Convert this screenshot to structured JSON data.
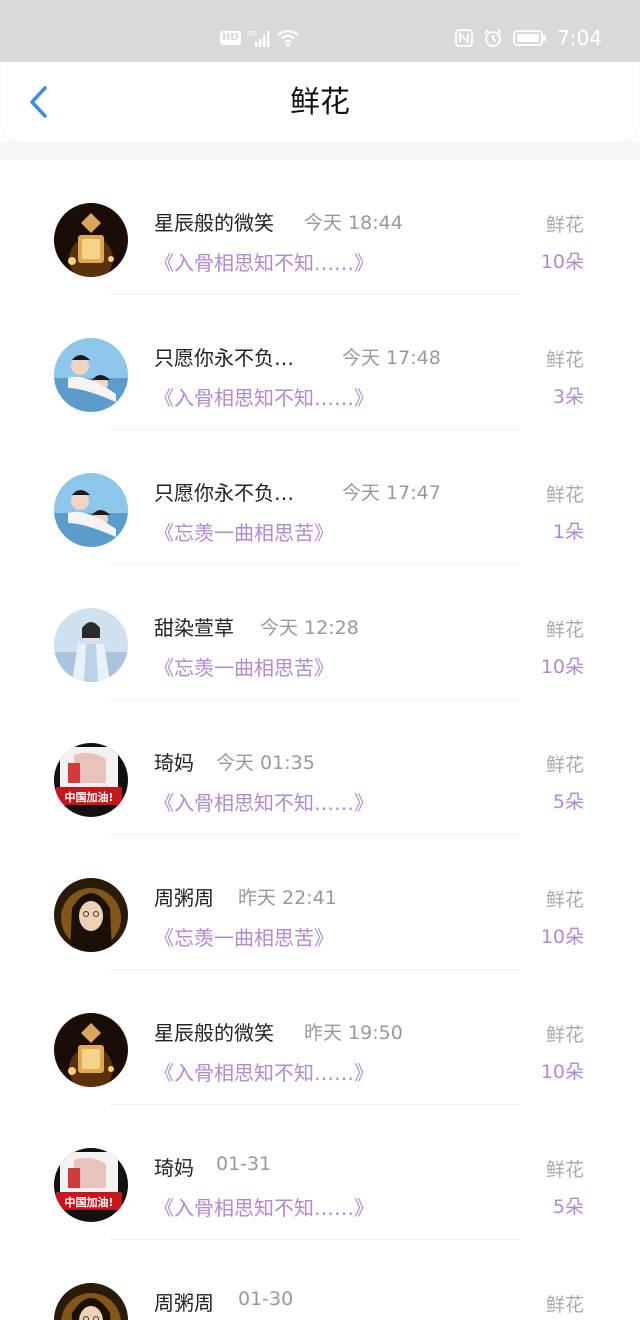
{
  "status_bar": {
    "hd": "HD",
    "network": "5G",
    "time": "7:04"
  },
  "header": {
    "title": "鲜花"
  },
  "items": [
    {
      "name": "星辰般的微笑",
      "time": "今天 18:44",
      "work": "《入骨相思知不知……》",
      "gift": "鲜花",
      "count": "10朵",
      "avatar": "perfume-bottle"
    },
    {
      "name": "只愿你永不负…",
      "time": "今天 17:48",
      "work": "《入骨相思知不知……》",
      "gift": "鲜花",
      "count": "3朵",
      "avatar": "couple-blue"
    },
    {
      "name": "只愿你永不负…",
      "time": "今天 17:47",
      "work": "《忘羡一曲相思苦》",
      "gift": "鲜花",
      "count": "1朵",
      "avatar": "couple-blue"
    },
    {
      "name": "甜染萱草",
      "time": "今天 12:28",
      "work": "《忘羡一曲相思苦》",
      "gift": "鲜花",
      "count": "10朵",
      "avatar": "costume-figure"
    },
    {
      "name": "琦妈",
      "time": "今天 01:35",
      "work": "《入骨相思知不知……》",
      "gift": "鲜花",
      "count": "5朵",
      "avatar": "china-banner",
      "avatar_text": "中国加油!"
    },
    {
      "name": "周粥周",
      "time": "昨天 22:41",
      "work": "《忘羡一曲相思苦》",
      "gift": "鲜花",
      "count": "10朵",
      "avatar": "woman-portrait"
    },
    {
      "name": "星辰般的微笑",
      "time": "昨天 19:50",
      "work": "《入骨相思知不知……》",
      "gift": "鲜花",
      "count": "10朵",
      "avatar": "perfume-bottle"
    },
    {
      "name": "琦妈",
      "time": "01-31",
      "work": "《入骨相思知不知……》",
      "gift": "鲜花",
      "count": "5朵",
      "avatar": "china-banner",
      "avatar_text": "中国加油!"
    },
    {
      "name": "周粥周",
      "time": "01-30",
      "work": "",
      "gift": "鲜花",
      "count": "",
      "avatar": "woman-portrait"
    }
  ]
}
